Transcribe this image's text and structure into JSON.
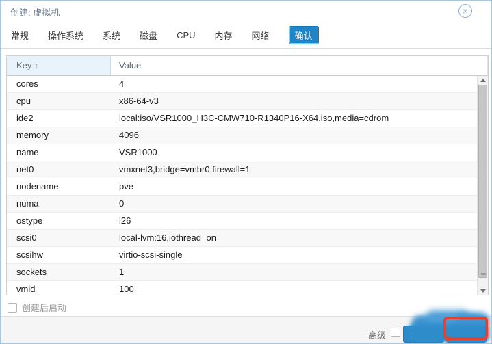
{
  "dialog": {
    "title": "创建: 虚拟机",
    "close_icon": "×"
  },
  "tabs": [
    {
      "label": "常规",
      "active": false
    },
    {
      "label": "操作系统",
      "active": false
    },
    {
      "label": "系统",
      "active": false
    },
    {
      "label": "磁盘",
      "active": false
    },
    {
      "label": "CPU",
      "active": false
    },
    {
      "label": "内存",
      "active": false
    },
    {
      "label": "网络",
      "active": false
    },
    {
      "label": "确认",
      "active": true
    }
  ],
  "table": {
    "columns": {
      "key": "Key",
      "value": "Value",
      "sort_indicator": "↑"
    },
    "rows": [
      {
        "key": "cores",
        "value": "4"
      },
      {
        "key": "cpu",
        "value": "x86-64-v3"
      },
      {
        "key": "ide2",
        "value": "local:iso/VSR1000_H3C-CMW710-R1340P16-X64.iso,media=cdrom"
      },
      {
        "key": "memory",
        "value": "4096"
      },
      {
        "key": "name",
        "value": "VSR1000"
      },
      {
        "key": "net0",
        "value": "vmxnet3,bridge=vmbr0,firewall=1"
      },
      {
        "key": "nodename",
        "value": "pve"
      },
      {
        "key": "numa",
        "value": "0"
      },
      {
        "key": "ostype",
        "value": "l26"
      },
      {
        "key": "scsi0",
        "value": "local-lvm:16,iothread=on"
      },
      {
        "key": "scsihw",
        "value": "virtio-scsi-single"
      },
      {
        "key": "sockets",
        "value": "1"
      },
      {
        "key": "vmid",
        "value": "100"
      }
    ]
  },
  "footer": {
    "start_after_label": "创建后启动",
    "advanced_label": "高级"
  },
  "colors": {
    "active_tab_blue": "#1e86c8",
    "button_blue": "#2d8bcb",
    "annotation_red": "#e8402f",
    "header_key_bg": "#e9f3fb",
    "footer_bg": "#f5f5f5"
  }
}
